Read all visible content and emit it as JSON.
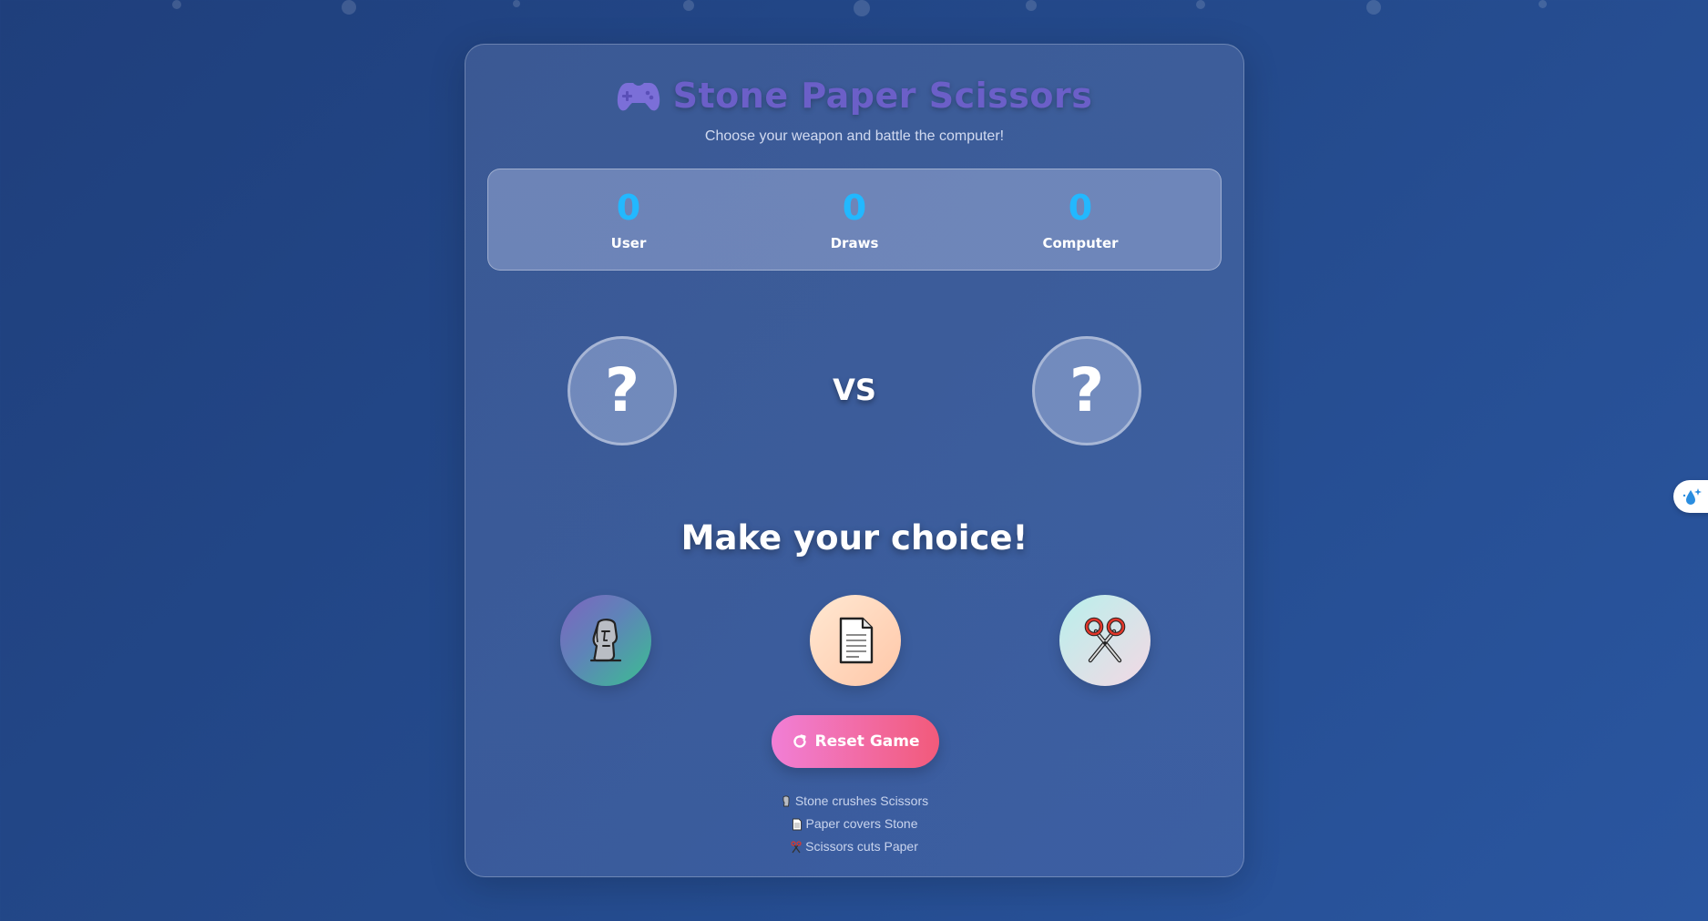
{
  "header": {
    "title": "Stone Paper Scissors",
    "title_icon": "gamepad-icon",
    "subtitle": "Choose your weapon and battle the computer!"
  },
  "scoreboard": {
    "user": {
      "value": "0",
      "label": "User"
    },
    "draws": {
      "value": "0",
      "label": "Draws"
    },
    "computer": {
      "value": "0",
      "label": "Computer"
    }
  },
  "arena": {
    "user_choice": "?",
    "vs": "VS",
    "computer_choice": "?"
  },
  "result_message": "Make your choice!",
  "weapons": [
    {
      "name": "stone",
      "icon": "moai-icon"
    },
    {
      "name": "paper",
      "icon": "document-icon"
    },
    {
      "name": "scissors",
      "icon": "scissors-icon"
    }
  ],
  "reset_button": {
    "label": "Reset Game",
    "icon": "refresh-icon"
  },
  "rules": [
    {
      "icon": "moai-icon",
      "text": "Stone crushes Scissors"
    },
    {
      "icon": "document-icon",
      "text": "Paper covers Stone"
    },
    {
      "icon": "scissors-icon",
      "text": "Scissors cuts Paper"
    }
  ],
  "colors": {
    "score_number": "#22b8ff",
    "title": "#6b5fc8",
    "reset_gradient_start": "#f17fd6",
    "reset_gradient_end": "#f25a7a"
  }
}
